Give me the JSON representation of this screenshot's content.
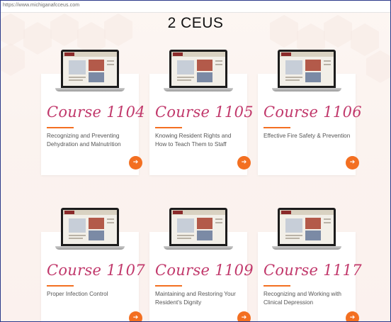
{
  "browser": {
    "url": "https://www.michiganafcceus.com"
  },
  "page": {
    "title": "2 CEUS"
  },
  "colors": {
    "accent": "#f36f21",
    "script": "#c1386b",
    "border": "#2b3a8a"
  },
  "icons": {
    "arrow": "arrow-right-icon"
  },
  "courses": [
    {
      "title": "Course 1104",
      "description": "Recognizing and Preventing Dehydration and Malnutrition",
      "arrow": "➔"
    },
    {
      "title": "Course 1105",
      "description": "Knowing Resident Rights and How to Teach Them to Staff",
      "arrow": "➔"
    },
    {
      "title": "Course 1106",
      "description": "Effective Fire Safety & Prevention",
      "arrow": "➔"
    },
    {
      "title": "Course 1107",
      "description": "Proper Infection Control",
      "arrow": "➔"
    },
    {
      "title": "Course 1109",
      "description": "Maintaining and Restoring Your Resident's Dignity",
      "arrow": "➔"
    },
    {
      "title": "Course 1117",
      "description": "Recognizing and Working with Clinical Depression",
      "arrow": "➔"
    }
  ]
}
